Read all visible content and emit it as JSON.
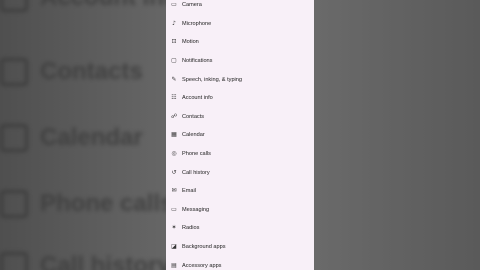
{
  "background": {
    "ghost_labels": [
      "Account info",
      "Contacts",
      "Calendar",
      "Phone calls",
      "Call history"
    ]
  },
  "nav": {
    "items": [
      {
        "label": "Camera",
        "icon": "camera-icon",
        "glyph": "▭"
      },
      {
        "label": "Microphone",
        "icon": "microphone-icon",
        "glyph": "♪"
      },
      {
        "label": "Motion",
        "icon": "motion-icon",
        "glyph": "⊡"
      },
      {
        "label": "Notifications",
        "icon": "notifications-icon",
        "glyph": "▢"
      },
      {
        "label": "Speech, inking, & typing",
        "icon": "speech-icon",
        "glyph": "✎"
      },
      {
        "label": "Account info",
        "icon": "account-info-icon",
        "glyph": "☷"
      },
      {
        "label": "Contacts",
        "icon": "contacts-icon",
        "glyph": "☍"
      },
      {
        "label": "Calendar",
        "icon": "calendar-icon",
        "glyph": "▦"
      },
      {
        "label": "Phone calls",
        "icon": "phone-calls-icon",
        "glyph": "◎"
      },
      {
        "label": "Call history",
        "icon": "call-history-icon",
        "glyph": "↺"
      },
      {
        "label": "Email",
        "icon": "email-icon",
        "glyph": "✉"
      },
      {
        "label": "Messaging",
        "icon": "messaging-icon",
        "glyph": "▭"
      },
      {
        "label": "Radios",
        "icon": "radios-icon",
        "glyph": "✶"
      },
      {
        "label": "Background apps",
        "icon": "background-apps-icon",
        "glyph": "◪"
      },
      {
        "label": "Accessory apps",
        "icon": "accessory-apps-icon",
        "glyph": "▤"
      }
    ]
  },
  "colors": {
    "panel_bg": "#f8f0f8",
    "backdrop": "#5b5b5b",
    "text": "#222222"
  }
}
